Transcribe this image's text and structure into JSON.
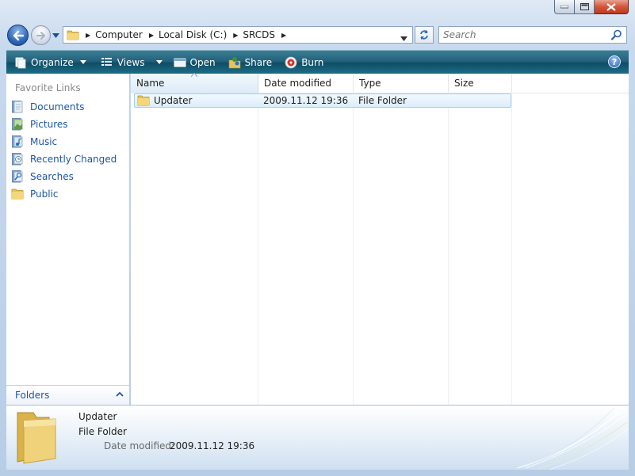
{
  "window": {
    "icon_names": [
      "minimize-icon",
      "maximize-icon",
      "close-icon"
    ]
  },
  "address": {
    "crumbs": [
      "Computer",
      "Local Disk (C:)",
      "SRCDS"
    ]
  },
  "search": {
    "placeholder": "Search"
  },
  "toolbar": {
    "organize": "Organize",
    "views": "Views",
    "open": "Open",
    "share": "Share",
    "burn": "Burn",
    "help": "?"
  },
  "navpane": {
    "heading": "Favorite Links",
    "items": [
      {
        "label": "Documents",
        "icon": "documents-icon"
      },
      {
        "label": "Pictures",
        "icon": "pictures-icon"
      },
      {
        "label": "Music",
        "icon": "music-icon"
      },
      {
        "label": "Recently Changed",
        "icon": "recently-changed-icon"
      },
      {
        "label": "Searches",
        "icon": "searches-icon"
      },
      {
        "label": "Public",
        "icon": "public-folder-icon"
      }
    ],
    "folders_label": "Folders"
  },
  "filelist": {
    "columns": [
      "Name",
      "Date modified",
      "Type",
      "Size"
    ],
    "sorted_column": "Name",
    "rows": [
      {
        "name": "Updater",
        "date_modified": "2009.11.12 19:36",
        "type": "File Folder",
        "size": ""
      }
    ]
  },
  "details": {
    "name": "Updater",
    "type": "File Folder",
    "date_label": "Date modified:",
    "date_value": "2009.11.12 19:36"
  },
  "colors": {
    "command_bar": "#23627c",
    "link_blue": "#1c55a6",
    "selection": "#dcedfb",
    "close_button": "#d2563a"
  }
}
